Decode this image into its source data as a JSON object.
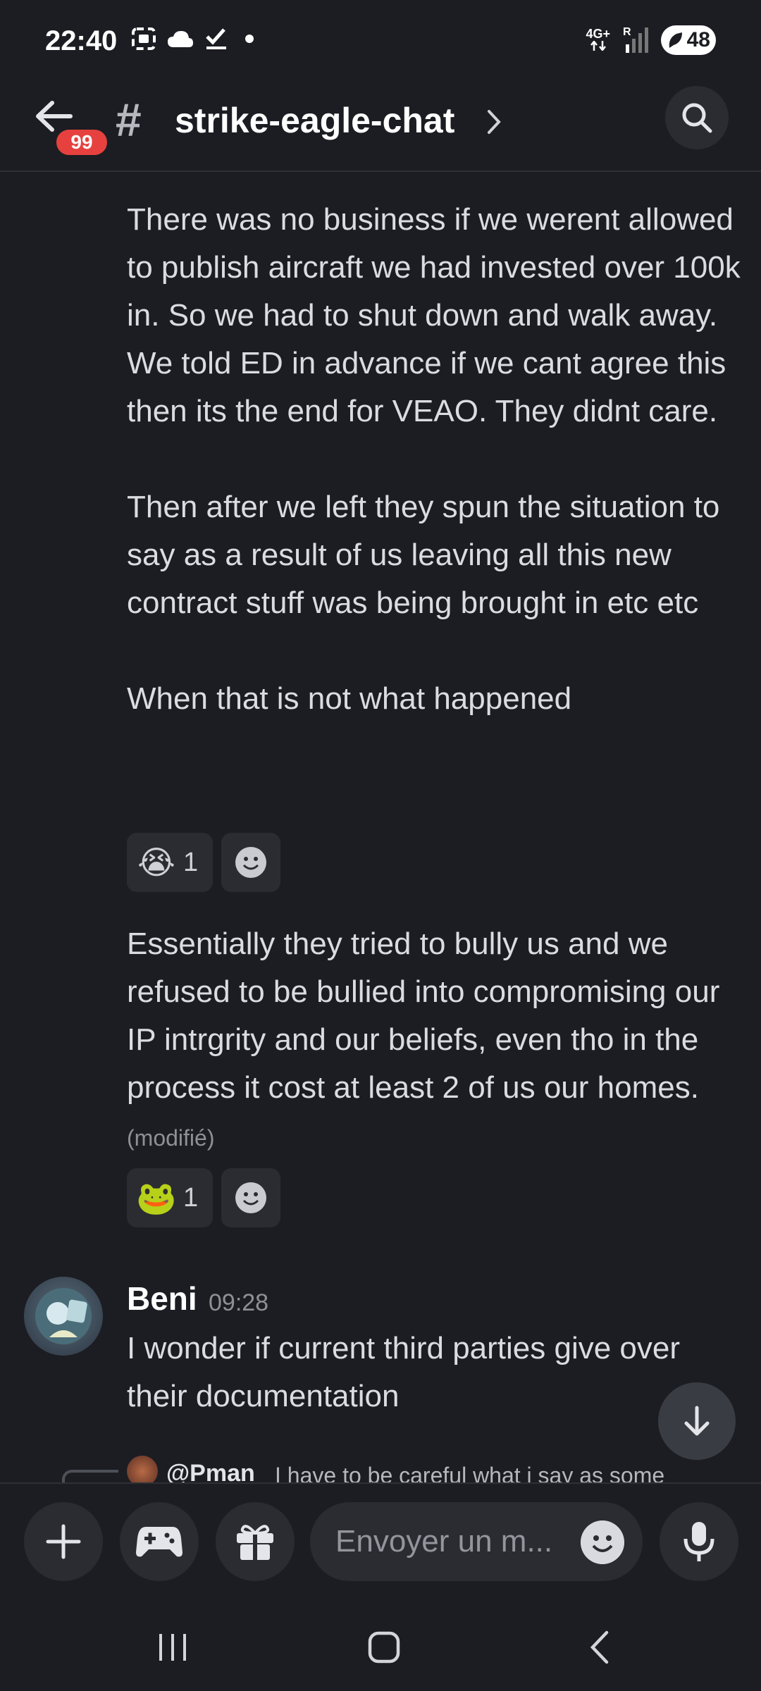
{
  "status_bar": {
    "time": "22:40",
    "network": "4G+",
    "roaming": "R",
    "battery": "48"
  },
  "header": {
    "back_badge": "99",
    "channel_prefix": "#",
    "channel_name": "strike-eagle-chat"
  },
  "messages": [
    {
      "text": "There was no business if we werent allowed to publish aircraft we had invested over 100k in. So we had to shut down and walk away. We told ED in advance if we cant agree this then its the end for VEAO. They didnt care.\n\nThen after we left they spun the situation to say as a result of us leaving all this new contract stuff was being brought in etc etc\n\nWhen that is not what happened",
      "reactions": [
        {
          "emoji": "😭",
          "count": "1"
        }
      ]
    },
    {
      "text": "Essentially they tried to bully us and we refused to be bullied into compromising our IP intrgrity and our beliefs, even tho in the process it cost at least 2 of us our homes.",
      "edited_label": "(modifié)",
      "reactions": [
        {
          "emoji": "🐸",
          "count": "1"
        }
      ]
    },
    {
      "author": "Beni",
      "time": "09:28",
      "text": "I wonder if current third parties give over their documentation"
    }
  ],
  "reply_preview": {
    "author": "@Pman",
    "text": "I have to be careful what i say as some"
  },
  "composer": {
    "placeholder": "Envoyer un m..."
  },
  "colors": {
    "background": "#1c1d22",
    "surface": "#2a2c32",
    "badge": "#e6413f",
    "text": "#dbdce0",
    "muted": "#8d9097"
  }
}
